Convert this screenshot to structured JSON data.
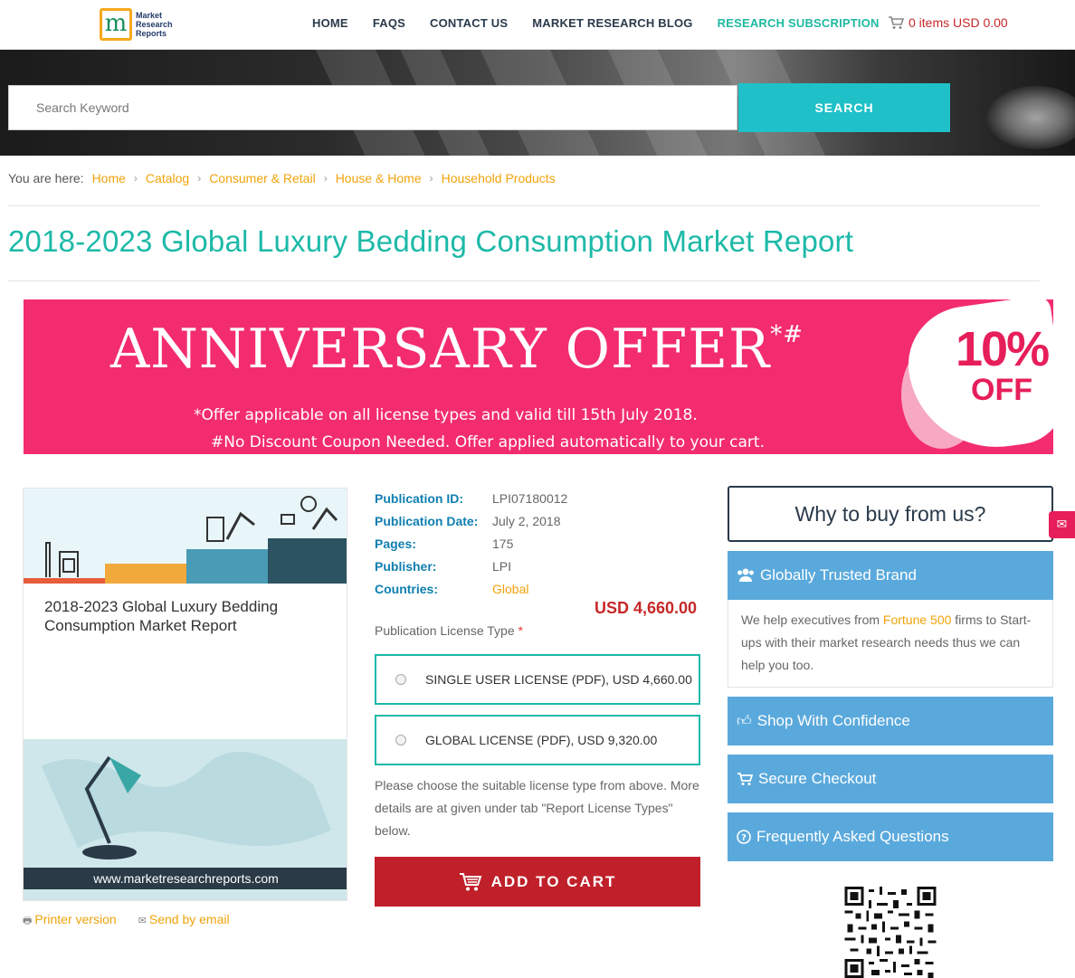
{
  "header": {
    "logo_text": [
      "Market",
      "Research",
      "Reports"
    ],
    "nav": [
      "HOME",
      "FAQS",
      "CONTACT US",
      "MARKET RESEARCH BLOG",
      "RESEARCH SUBSCRIPTION"
    ],
    "cart": "0 items USD 0.00"
  },
  "search": {
    "placeholder": "Search Keyword",
    "button": "SEARCH"
  },
  "breadcrumb": {
    "prefix": "You are here:",
    "items": [
      "Home",
      "Catalog",
      "Consumer & Retail",
      "House & Home",
      "Household Products"
    ]
  },
  "page_title": "2018-2023 Global Luxury Bedding Consumption Market Report",
  "banner": {
    "headline": "ANNIVERSARY OFFER",
    "mark": "*#",
    "line1": "*Offer applicable on all license types and valid till 15th July 2018.",
    "line2": "#No Discount Coupon Needed. Offer applied automatically to your cart.",
    "badge_pct": "10%",
    "badge_off": "OFF"
  },
  "product": {
    "card_title": "2018-2023 Global Luxury Bedding Consumption Market Report",
    "footer_url": "www.marketresearchreports.com",
    "printer": "Printer version",
    "email": "Send by email"
  },
  "info": {
    "rows": [
      {
        "k": "Publication ID:",
        "v": "LPI07180012"
      },
      {
        "k": "Publication Date:",
        "v": "July 2, 2018"
      },
      {
        "k": "Pages:",
        "v": "175"
      },
      {
        "k": "Publisher:",
        "v": "LPI"
      },
      {
        "k": "Countries:",
        "v": "Global"
      }
    ],
    "price": "USD 4,660.00",
    "license_label": "Publication License Type",
    "required": "*",
    "licenses": [
      "SINGLE USER LICENSE (PDF), USD 4,660.00",
      "GLOBAL LICENSE (PDF), USD 9,320.00"
    ],
    "note": "Please choose the suitable license type from above. More details are at given under tab \"Report License Types\" below.",
    "add_to_cart": "ADD TO CART"
  },
  "why": {
    "title": "Why to buy from us?",
    "items": [
      "Globally Trusted Brand",
      "Shop With Confidence",
      "Secure Checkout",
      "Frequently Asked Questions"
    ],
    "body_pre": "We help executives from ",
    "body_hl": "Fortune 500",
    "body_post": " firms to Start-ups with their market research needs thus we can help you too."
  },
  "colors": {
    "accent": "#1db9a8",
    "brand_red": "#c0202a",
    "banner_pink": "#f32c6f",
    "link": "#f0a30a",
    "panel_blue": "#5aa9dc"
  }
}
